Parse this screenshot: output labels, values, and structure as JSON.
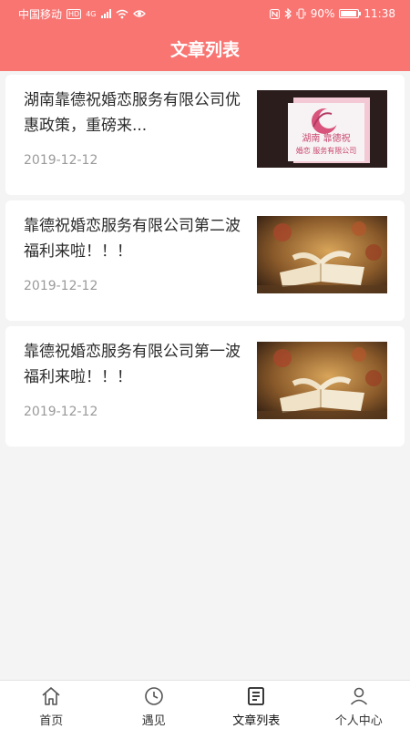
{
  "status_bar": {
    "carrier": "中国移动",
    "network": "4G",
    "battery": "90%",
    "time": "11:38"
  },
  "header": {
    "title": "文章列表"
  },
  "articles": [
    {
      "title": "湖南靠德祝婚恋服务有限公司优惠政策，重磅来...",
      "date": "2019-12-12",
      "thumb_icon": "company-logo-image",
      "logo_text": "湖南 靠德祝",
      "logo_sub": "婚恋 服务有限公司"
    },
    {
      "title": "靠德祝婚恋服务有限公司第二波福利来啦！！！",
      "date": "2019-12-12",
      "thumb_icon": "open-book-image"
    },
    {
      "title": "靠德祝婚恋服务有限公司第一波福利来啦！！！",
      "date": "2019-12-12",
      "thumb_icon": "open-book-image"
    }
  ],
  "tabbar": {
    "tabs": [
      {
        "label": "首页",
        "icon": "home-icon"
      },
      {
        "label": "遇见",
        "icon": "clock-icon"
      },
      {
        "label": "文章列表",
        "icon": "article-list-icon",
        "active": true
      },
      {
        "label": "个人中心",
        "icon": "person-icon"
      }
    ]
  },
  "colors": {
    "header": "#f87572",
    "background": "#f4f4f4",
    "date_text": "#9a9a9a"
  }
}
